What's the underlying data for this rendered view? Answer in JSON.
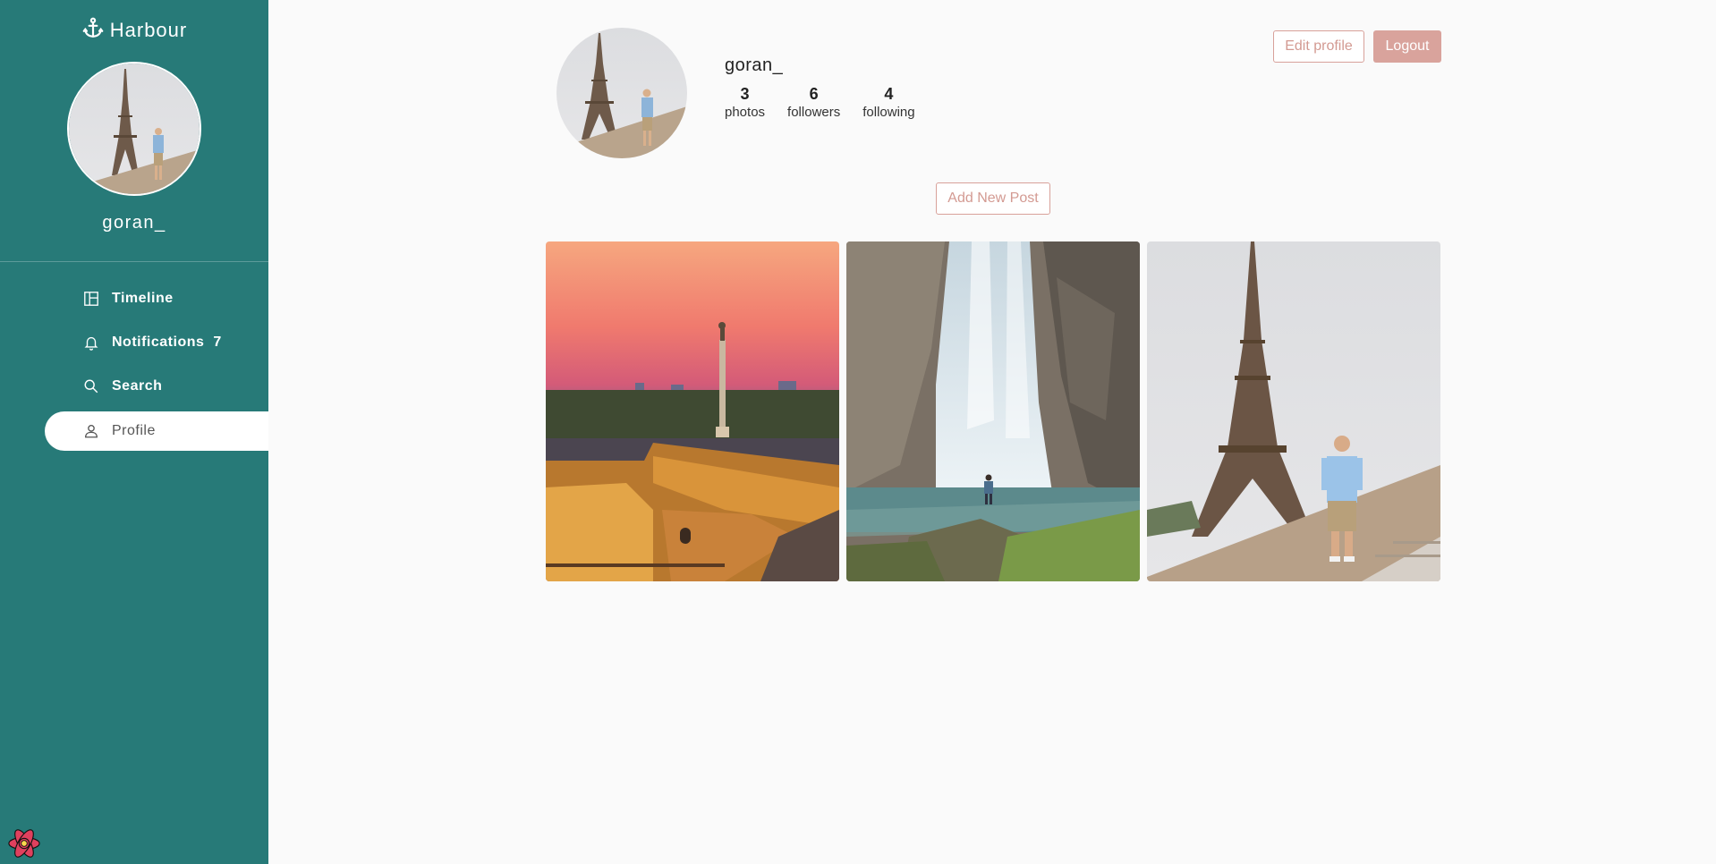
{
  "app": {
    "title": "Harbour"
  },
  "sidebar": {
    "username": "goran_",
    "items": [
      {
        "label": "Timeline",
        "icon": "layout-icon"
      },
      {
        "label": "Notifications",
        "icon": "bell-icon",
        "badge": "7"
      },
      {
        "label": "Search",
        "icon": "search-icon"
      },
      {
        "label": "Profile",
        "icon": "user-icon",
        "active": true
      }
    ]
  },
  "profile": {
    "username": "goran_",
    "stats": [
      {
        "value": "3",
        "label": "photos"
      },
      {
        "value": "6",
        "label": "followers"
      },
      {
        "value": "4",
        "label": "following"
      }
    ],
    "edit_label": "Edit profile",
    "logout_label": "Logout",
    "add_post_label": "Add New Post"
  },
  "posts": [
    {
      "subject": "monument-at-sunset"
    },
    {
      "subject": "waterfall"
    },
    {
      "subject": "eiffel-tower-portrait"
    }
  ],
  "colors": {
    "sidebar": "#277a78",
    "accent": "#d9a39c",
    "background": "#fafafa"
  }
}
